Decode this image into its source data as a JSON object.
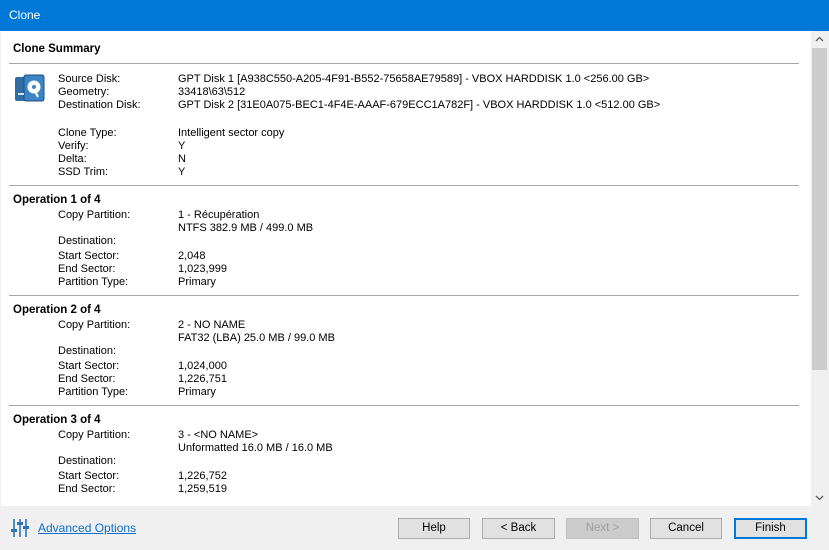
{
  "window": {
    "title": "Clone"
  },
  "summary": {
    "heading": "Clone Summary",
    "source_disk_label": "Source Disk:",
    "source_disk_value": "GPT Disk 1 [A938C550-A205-4F91-B552-75658AE79589] - VBOX HARDDISK 1.0  <256.00 GB>",
    "geometry_label": "Geometry:",
    "geometry_value": "33418\\63\\512",
    "destination_disk_label": "Destination Disk:",
    "destination_disk_value": "GPT Disk 2 [31E0A075-BEC1-4F4E-AAAF-679ECC1A782F] - VBOX HARDDISK 1.0  <512.00 GB>",
    "clone_type_label": "Clone Type:",
    "clone_type_value": "Intelligent sector copy",
    "verify_label": "Verify:",
    "verify_value": "Y",
    "delta_label": "Delta:",
    "delta_value": "N",
    "ssd_trim_label": "SSD Trim:",
    "ssd_trim_value": "Y"
  },
  "operations": [
    {
      "heading": "Operation 1 of 4",
      "copy_partition_label": "Copy Partition:",
      "copy_partition_value": "1 - Récupération",
      "filesystem_value": "NTFS 382.9 MB / 499.0 MB",
      "destination_label": "Destination:",
      "start_sector_label": "Start Sector:",
      "start_sector_value": "2,048",
      "end_sector_label": "End Sector:",
      "end_sector_value": "1,023,999",
      "partition_type_label": "Partition Type:",
      "partition_type_value": "Primary"
    },
    {
      "heading": "Operation 2 of 4",
      "copy_partition_label": "Copy Partition:",
      "copy_partition_value": "2 - NO NAME",
      "filesystem_value": "FAT32 (LBA) 25.0 MB / 99.0 MB",
      "destination_label": "Destination:",
      "start_sector_label": "Start Sector:",
      "start_sector_value": "1,024,000",
      "end_sector_label": "End Sector:",
      "end_sector_value": "1,226,751",
      "partition_type_label": "Partition Type:",
      "partition_type_value": "Primary"
    },
    {
      "heading": "Operation 3 of 4",
      "copy_partition_label": "Copy Partition:",
      "copy_partition_value": "3 - <NO NAME>",
      "filesystem_value": "Unformatted 16.0 MB / 16.0 MB",
      "destination_label": "Destination:",
      "start_sector_label": "Start Sector:",
      "start_sector_value": "1,226,752",
      "end_sector_label": "End Sector:",
      "end_sector_value": "1,259,519"
    }
  ],
  "footer": {
    "advanced_options_icon": "sliders-icon",
    "advanced_options_label": "Advanced Options",
    "help_label": "Help",
    "back_label": "< Back",
    "next_label": "Next >",
    "cancel_label": "Cancel",
    "finish_label": "Finish"
  },
  "colors": {
    "titlebar": "#0078d7",
    "link": "#0b6fc9",
    "default_button_border": "#0078d7"
  }
}
